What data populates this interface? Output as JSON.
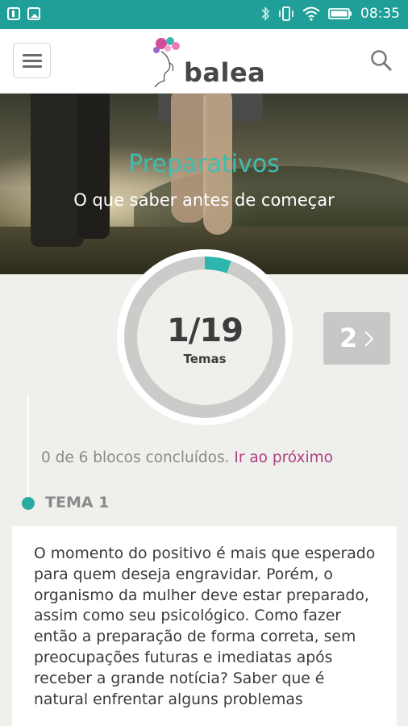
{
  "status_bar": {
    "time": "08:35",
    "bg_color": "#1f9f97",
    "left_icons": [
      "notification-icon",
      "image-icon"
    ],
    "right_icons": [
      "bluetooth-icon",
      "vibrate-icon",
      "wifi-icon",
      "battery-icon"
    ]
  },
  "header": {
    "logo_text": "balea",
    "menu_icon": "hamburger-menu-icon",
    "search_icon": "search-icon"
  },
  "hero": {
    "title": "Preparativos",
    "subtitle": "O que saber antes de começar",
    "title_color": "#3fbdb0"
  },
  "progress": {
    "count": "1/19",
    "label": "Temas",
    "fraction_complete": 0.053,
    "accent_color": "#2db6ad"
  },
  "next": {
    "number": "2",
    "icon": "chevron-right-icon"
  },
  "blocks": {
    "status_text": "0 de 6 blocos concluídos.",
    "link_text": "Ir ao próximo",
    "link_color": "#b03f86"
  },
  "tema": {
    "label": "TEMA 1",
    "text": "O momento do positivo é mais que esperado para quem deseja engravidar. Porém, o organismo da mulher deve estar preparado, assim como seu psicológico. Como fazer então a preparação de forma correta, sem preocupações futuras e imediatas após receber a grande notícia? Saber que é natural enfrentar alguns problemas"
  }
}
